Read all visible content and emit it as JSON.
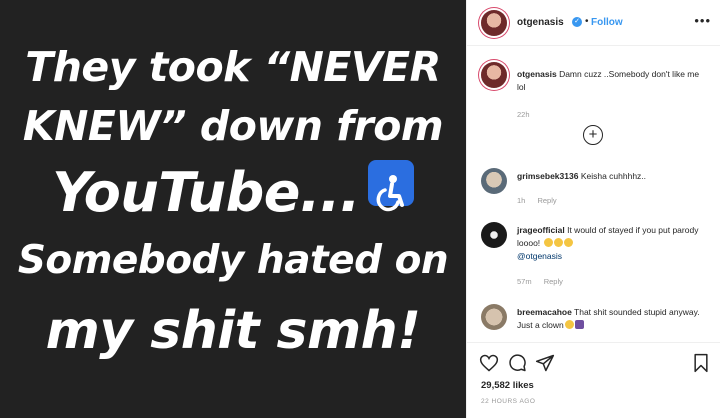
{
  "media": {
    "lines": [
      "They took “NEVER",
      "KNEW” down from",
      "YouTube...",
      "Somebody hated on",
      "my shit smh!"
    ]
  },
  "header": {
    "username": "otgenasis",
    "separator": "•",
    "follow": "Follow",
    "more": "•••"
  },
  "caption": {
    "username": "otgenasis",
    "text": "Damn cuzz ..Somebody don't like me lol",
    "time": "22h"
  },
  "comments": [
    {
      "username": "grimsebek3136",
      "text": "Keisha cuhhhhz..",
      "time": "1h",
      "reply": "Reply"
    },
    {
      "username": "jrageofficial",
      "text": "It would of stayed if you put parody loooo!",
      "mention": "@otgenasis",
      "time": "57m",
      "reply": "Reply"
    },
    {
      "username": "breemacahoe",
      "text": "That shit sounded stupid anyway. Just a clown",
      "time": "",
      "reply": ""
    }
  ],
  "stats": {
    "likes": "29,582 likes",
    "time_ago": "22 HOURS AGO"
  },
  "colors": {
    "media_bg": "#222222",
    "accent": "#3897f0",
    "wheelchair": "#2b6ee0"
  }
}
